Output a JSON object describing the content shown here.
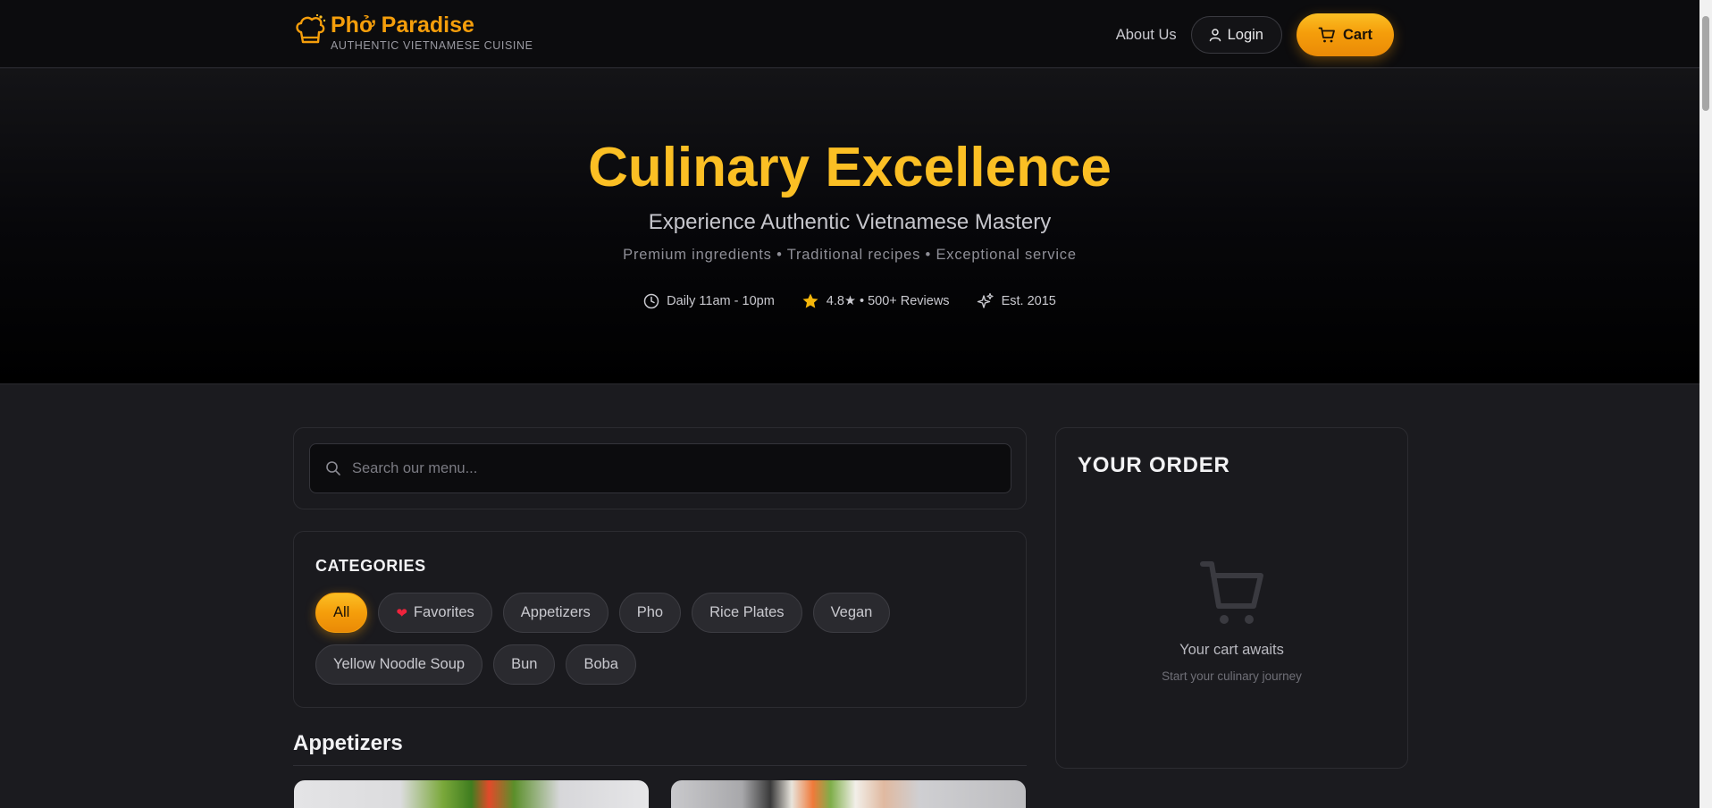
{
  "header": {
    "brand_name": "Phở Paradise",
    "brand_tagline": "AUTHENTIC VIETNAMESE CUISINE",
    "brand_icon": "chef-hat-icon",
    "nav": {
      "about_label": "About Us",
      "login_label": "Login",
      "cart_label": "Cart"
    }
  },
  "hero": {
    "title": "Culinary Excellence",
    "subtitle": "Experience Authentic Vietnamese Mastery",
    "tagline": "Premium ingredients • Traditional recipes • Exceptional service",
    "stats": [
      {
        "icon": "clock-icon",
        "text": "Daily 11am - 10pm"
      },
      {
        "icon": "star-icon",
        "text": "4.8★ • 500+ Reviews"
      },
      {
        "icon": "sparkles-icon",
        "text": "Est. 2015"
      }
    ]
  },
  "search": {
    "placeholder": "Search our menu..."
  },
  "categories": {
    "title": "CATEGORIES",
    "items": [
      {
        "label": "All",
        "active": true
      },
      {
        "label": "Favorites",
        "icon": "heart-icon"
      },
      {
        "label": "Appetizers"
      },
      {
        "label": "Pho"
      },
      {
        "label": "Rice Plates"
      },
      {
        "label": "Vegan"
      },
      {
        "label": "Yellow Noodle Soup"
      },
      {
        "label": "Bun"
      },
      {
        "label": "Boba"
      }
    ]
  },
  "menu": {
    "section_title": "Appetizers"
  },
  "order": {
    "title": "YOUR ORDER",
    "empty_title": "Your cart awaits",
    "empty_subtitle": "Start your culinary journey"
  },
  "colors": {
    "accent": "#f59e0b",
    "accent_light": "#fbbf24",
    "background": "#1b1b1f",
    "header_bg": "#0c0c0e",
    "favorite_heart": "#ef233c"
  }
}
